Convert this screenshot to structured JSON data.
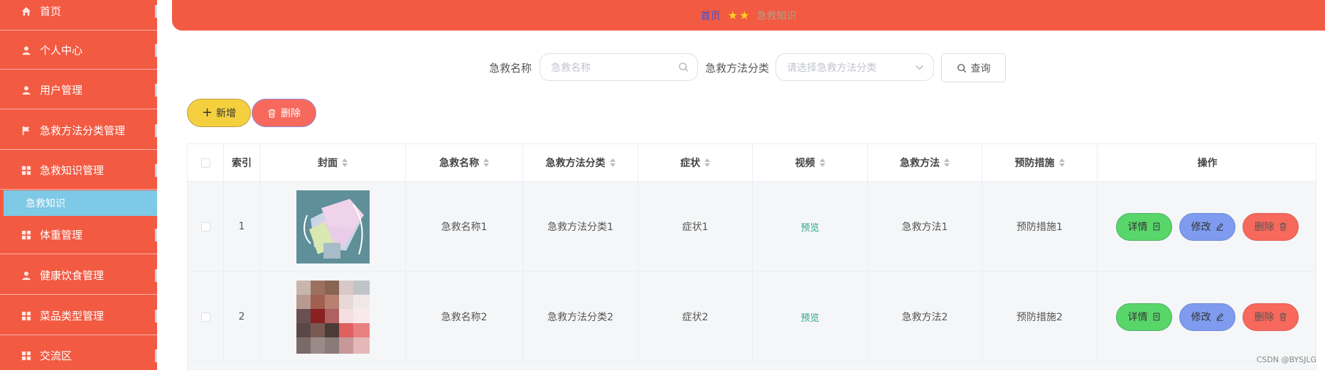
{
  "sidebar": {
    "items": [
      {
        "label": "首页",
        "icon": "home-icon"
      },
      {
        "label": "个人中心",
        "icon": "user-icon"
      },
      {
        "label": "用户管理",
        "icon": "user-icon"
      },
      {
        "label": "急救方法分类管理",
        "icon": "flag-icon"
      },
      {
        "label": "急救知识管理",
        "icon": "grid-icon"
      },
      {
        "label": "体重管理",
        "icon": "grid-icon"
      },
      {
        "label": "健康饮食管理",
        "icon": "user-icon"
      },
      {
        "label": "菜品类型管理",
        "icon": "grid-icon"
      },
      {
        "label": "交流区",
        "icon": "grid-icon"
      }
    ],
    "active_sub": "急救知识"
  },
  "header": {
    "home": "首页",
    "stars": "★★",
    "current": "急救知识"
  },
  "search": {
    "name_label": "急救名称",
    "name_placeholder": "急救名称",
    "category_label": "急救方法分类",
    "category_placeholder": "请选择急救方法分类",
    "query_label": "查询"
  },
  "actions": {
    "add_label": "新增",
    "delete_label": "删除"
  },
  "table": {
    "columns": [
      "索引",
      "封面",
      "急救名称",
      "急救方法分类",
      "症状",
      "视频",
      "急救方法",
      "预防措施",
      "操作"
    ],
    "rows": [
      {
        "index": "1",
        "name": "急救名称1",
        "category": "急救方法分类1",
        "symptom": "症状1",
        "video": "预览",
        "method": "急救方法1",
        "prevention": "预防措施1"
      },
      {
        "index": "2",
        "name": "急救名称2",
        "category": "急救方法分类2",
        "symptom": "症状2",
        "video": "预览",
        "method": "急救方法2",
        "prevention": "预防措施2"
      }
    ],
    "ops": {
      "detail": "详情",
      "edit": "修改",
      "remove": "删除"
    }
  },
  "watermark": "CSDN @BYSJLG",
  "colors": {
    "sidebar": "#f25a42",
    "header": "#f25a42",
    "active_sub": "#7ec9e6",
    "add_button": "#f5d03e",
    "delete_button": "#f7695c",
    "detail_button": "#58d66a",
    "edit_button": "#7e9bf0",
    "preview_link": "#2aa58e"
  }
}
